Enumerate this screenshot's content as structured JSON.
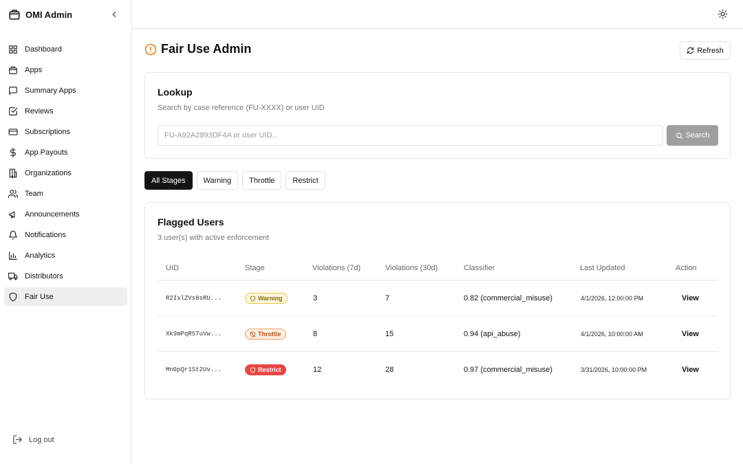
{
  "app": {
    "title": "OMI Admin"
  },
  "sidebar": {
    "items": [
      {
        "label": "Dashboard",
        "icon": "grid-icon"
      },
      {
        "label": "Apps",
        "icon": "package-icon"
      },
      {
        "label": "Summary Apps",
        "icon": "message-square-icon"
      },
      {
        "label": "Reviews",
        "icon": "check-square-icon"
      },
      {
        "label": "Subscriptions",
        "icon": "credit-card-icon"
      },
      {
        "label": "App Payouts",
        "icon": "dollar-icon"
      },
      {
        "label": "Organizations",
        "icon": "building-icon"
      },
      {
        "label": "Team",
        "icon": "users-icon"
      },
      {
        "label": "Announcements",
        "icon": "megaphone-icon"
      },
      {
        "label": "Notifications",
        "icon": "bell-icon"
      },
      {
        "label": "Analytics",
        "icon": "bar-chart-icon"
      },
      {
        "label": "Distributors",
        "icon": "truck-icon"
      },
      {
        "label": "Fair Use",
        "icon": "shield-icon",
        "active": true
      }
    ],
    "logout_label": "Log out"
  },
  "page": {
    "title": "Fair Use Admin",
    "refresh_label": "Refresh"
  },
  "lookup": {
    "title": "Lookup",
    "subtitle": "Search by case reference (FU-XXXX) or user UID",
    "placeholder": "FU-A92A2893DF4A or user UID...",
    "value": "",
    "search_label": "Search"
  },
  "filters": [
    {
      "label": "All Stages",
      "active": true
    },
    {
      "label": "Warning",
      "active": false
    },
    {
      "label": "Throttle",
      "active": false
    },
    {
      "label": "Restrict",
      "active": false
    }
  ],
  "flagged": {
    "title": "Flagged Users",
    "subtitle": "3 user(s) with active enforcement",
    "columns": {
      "uid": "UID",
      "stage": "Stage",
      "v7": "Violations (7d)",
      "v30": "Violations (30d)",
      "classifier": "Classifier",
      "updated": "Last Updated",
      "action": "Action"
    },
    "rows": [
      {
        "uid": "R2IxlZVs8sRU...",
        "stage": "Warning",
        "v7": "3",
        "v30": "7",
        "classifier": "0.82 (commercial_misuse)",
        "updated": "4/1/2026, 12:00:00 PM",
        "action": "View"
      },
      {
        "uid": "Xk9mPqR5TuVw...",
        "stage": "Throttle",
        "v7": "8",
        "v30": "15",
        "classifier": "0.94 (api_abuse)",
        "updated": "4/1/2026, 10:00:00 AM",
        "action": "View"
      },
      {
        "uid": "Mn0pQr1St2Uv...",
        "stage": "Restrict",
        "v7": "12",
        "v30": "28",
        "classifier": "0.97 (commercial_misuse)",
        "updated": "3/31/2026, 10:00:00 PM",
        "action": "View"
      }
    ]
  },
  "colors": {
    "accent_orange": "#ea7a18",
    "warning_border": "#f1c43f",
    "throttle_text": "#c2531a",
    "restrict_bg": "#e74646",
    "active_filter": "#151515"
  }
}
